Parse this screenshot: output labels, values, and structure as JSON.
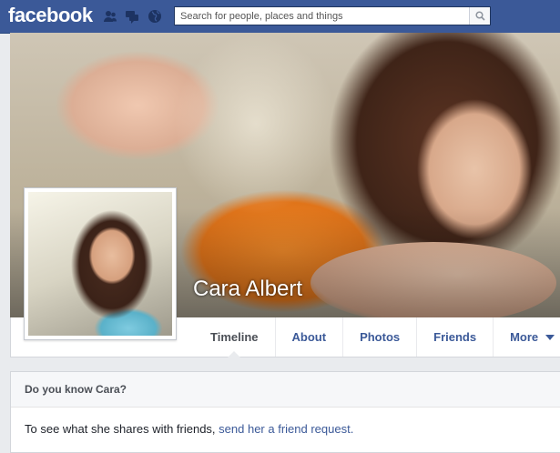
{
  "header": {
    "logo": "facebook",
    "search_placeholder": "Search for people, places and things",
    "brand_color": "#3b5998",
    "jewels": [
      "friend-requests-icon",
      "messages-icon",
      "notifications-globe-icon"
    ]
  },
  "profile": {
    "name": "Cara Albert"
  },
  "tabs": [
    {
      "label": "Timeline",
      "active": true
    },
    {
      "label": "About"
    },
    {
      "label": "Photos"
    },
    {
      "label": "Friends"
    },
    {
      "label": "More"
    }
  ],
  "know_card": {
    "title": "Do you know Cara?",
    "text_prefix": "To see what she shares with friends, ",
    "link_text": "send her a friend request."
  }
}
